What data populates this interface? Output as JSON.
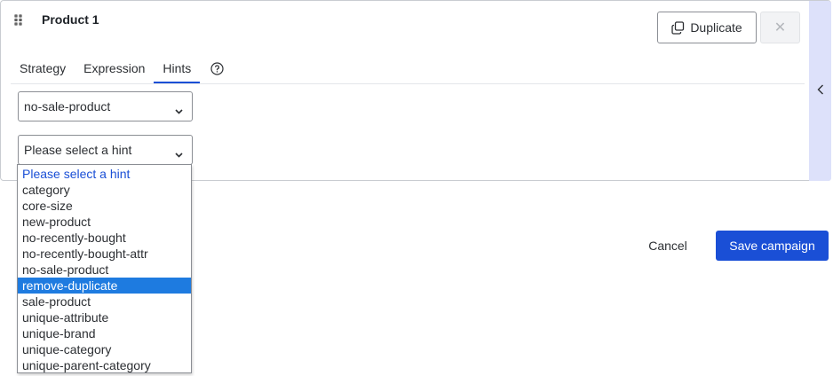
{
  "card": {
    "title": "Product 1",
    "duplicate_label": "Duplicate",
    "close_glyph": "✕"
  },
  "tabs": [
    {
      "label": "Strategy",
      "active": false
    },
    {
      "label": "Expression",
      "active": false
    },
    {
      "label": "Hints",
      "active": true
    }
  ],
  "hint_selector_1": {
    "value": "no-sale-product"
  },
  "hint_selector_2": {
    "value": "Please select a hint",
    "options": [
      "Please select a hint",
      "category",
      "core-size",
      "new-product",
      "no-recently-bought",
      "no-recently-bought-attr",
      "no-sale-product",
      "remove-duplicate",
      "sale-product",
      "unique-attribute",
      "unique-brand",
      "unique-category",
      "unique-parent-category"
    ],
    "highlighted": "remove-duplicate"
  },
  "footer": {
    "cancel_label": "Cancel",
    "save_label": "Save campaign"
  },
  "colors": {
    "accent": "#1a4fd6",
    "highlight": "#1e7be0",
    "side_panel": "#dde1fa"
  },
  "icons": {
    "drag": "drag-handle-icon",
    "duplicate": "copy-icon",
    "close": "close-icon",
    "help": "question-circle-icon",
    "chevron": "chevron-down-icon",
    "collapse": "chevron-left-icon"
  }
}
